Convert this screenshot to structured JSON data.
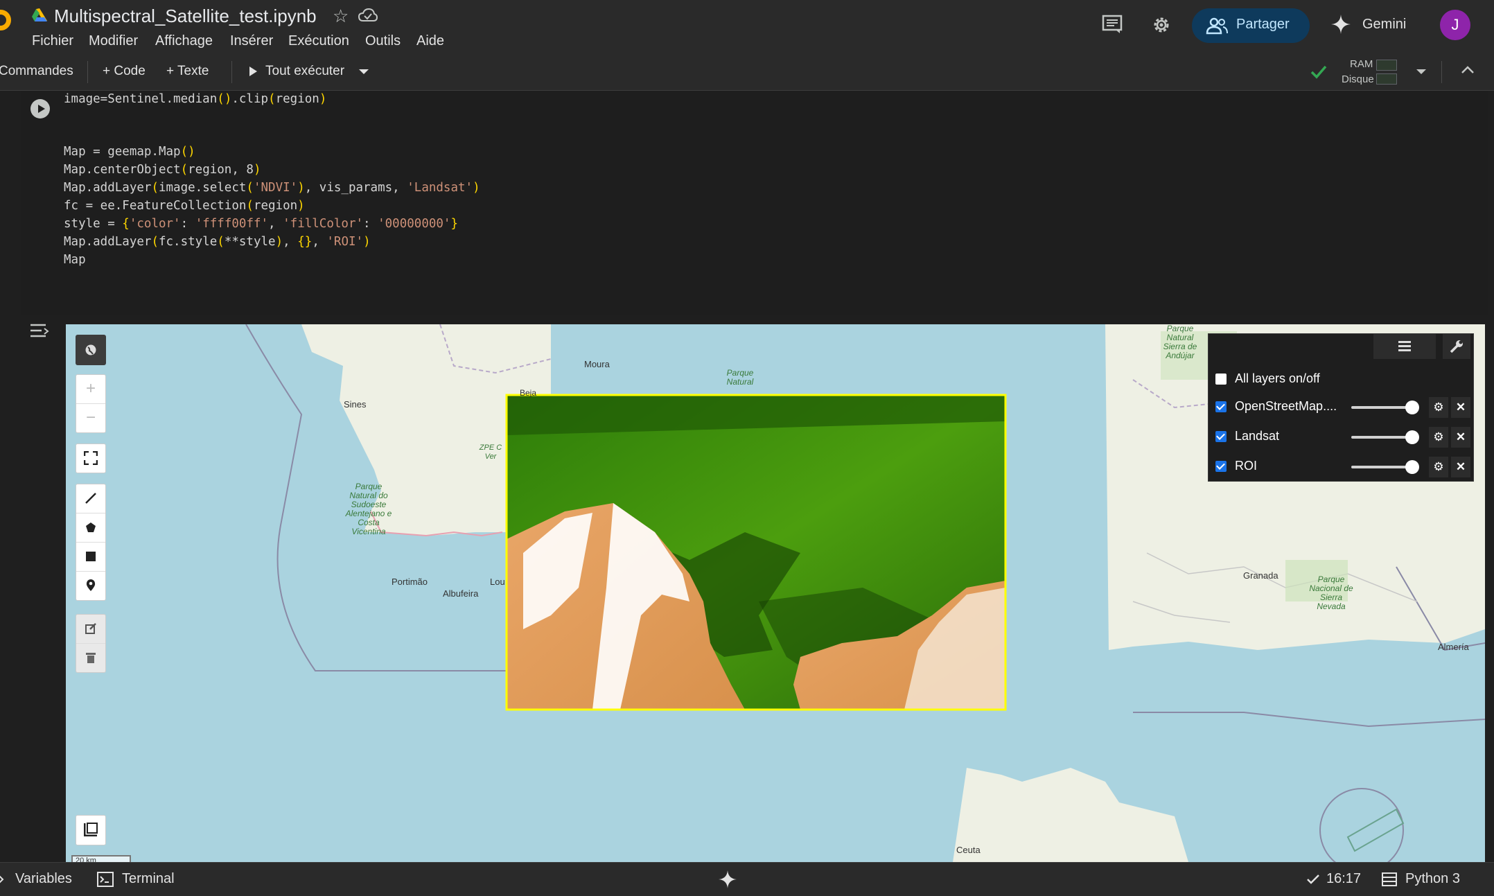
{
  "header": {
    "notebook_title": "Multispectral_Satellite_test.ipynb",
    "menu": [
      "Fichier",
      "Modifier",
      "Affichage",
      "Insérer",
      "Exécution",
      "Outils",
      "Aide"
    ],
    "share_label": "Partager",
    "gemini_label": "Gemini",
    "avatar_letter": "J",
    "icons": [
      "colab-logo-icon",
      "drive-icon",
      "star-icon",
      "cloud-saved-icon",
      "comments-icon",
      "settings-icon",
      "share-people-icon",
      "gemini-sparkle-icon"
    ]
  },
  "toolbar": {
    "commands_label": "Commandes",
    "add_code_label": "+ Code",
    "add_text_label": "+ Texte",
    "run_all_label": "Tout exécuter",
    "ram_label": "RAM",
    "disk_label": "Disque"
  },
  "code": {
    "lines": [
      "image=Sentinel.median().clip(region)",
      "",
      "",
      "Map = geemap.Map()",
      "Map.centerObject(region, 8)",
      "Map.addLayer(image.select('NDVI'), vis_params, 'Landsat')",
      "fc = ee.FeatureCollection(region)",
      "style = {'color': 'ffff00ff', 'fillColor': '00000000'}",
      "Map.addLayer(fc.style(**style), {}, 'ROI')",
      "Map"
    ]
  },
  "map": {
    "zoom_in": "+",
    "zoom_out": "−",
    "scale_label": "20 km",
    "places": [
      "Moura",
      "Beja",
      "Sines",
      "Portimão",
      "Albufeira",
      "Lou",
      "Granada",
      "Almería",
      "Ceuta",
      "ZPE C Ver"
    ],
    "parks": [
      "Parque Natural do Sudoeste Alentejano e Costa Vicentina",
      "Parque Natural",
      "Parque Natural Sierra de Andújar",
      "Parque Nacional de Sierra Nevada"
    ],
    "roi_color": "#ffff00",
    "layer_panel": {
      "all_layers_label": "All layers on/off",
      "layers": [
        {
          "name": "OpenStreetMap....",
          "checked": true,
          "opacity": 1.0
        },
        {
          "name": "Landsat",
          "checked": true,
          "opacity": 1.0
        },
        {
          "name": "ROI",
          "checked": true,
          "opacity": 1.0
        }
      ]
    }
  },
  "status": {
    "variables_label": "Variables",
    "terminal_label": "Terminal",
    "time": "16:17",
    "runtime_label": "Python 3"
  },
  "colors": {
    "accent_share_bg": "#0e3a5c",
    "avatar_bg": "#8e24aa",
    "checkbox_blue": "#1a73e8",
    "check_green": "#34a853"
  }
}
